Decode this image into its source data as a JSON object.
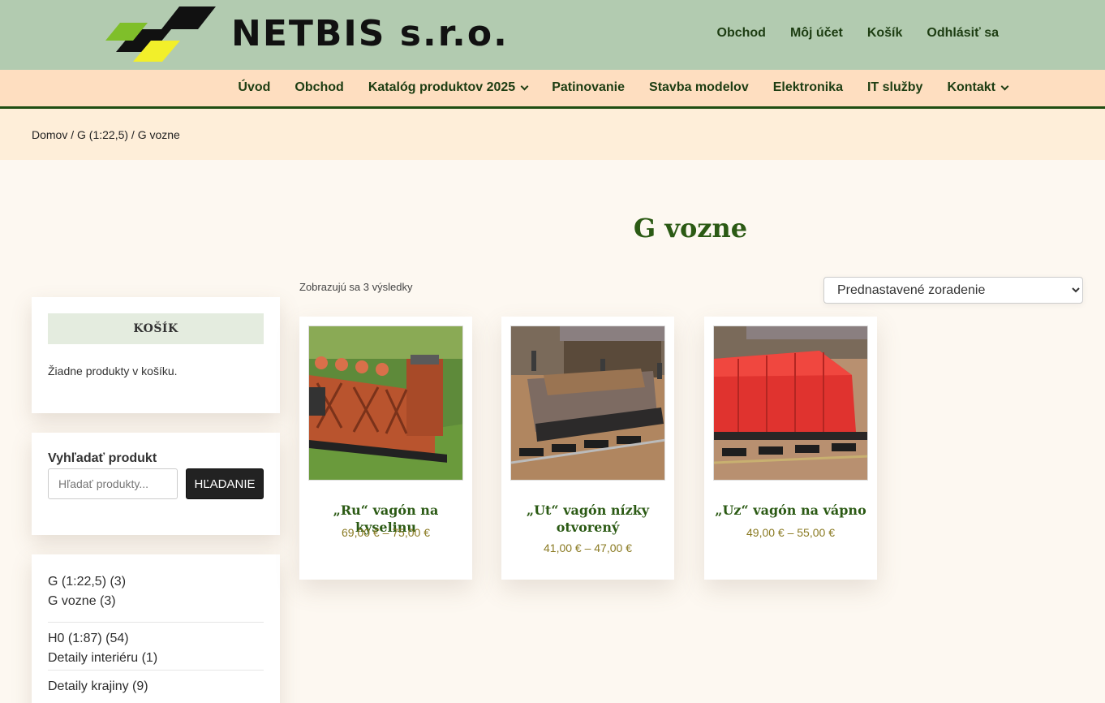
{
  "brand": {
    "name": "NETBIS s.r.o."
  },
  "top_nav": [
    "Obchod",
    "Môj účet",
    "Košík",
    "Odhlásiť sa"
  ],
  "main_nav": [
    {
      "label": "Úvod",
      "dropdown": false
    },
    {
      "label": "Obchod",
      "dropdown": false
    },
    {
      "label": "Katalóg produktov 2025",
      "dropdown": true
    },
    {
      "label": "Patinovanie",
      "dropdown": false
    },
    {
      "label": "Stavba modelov",
      "dropdown": false
    },
    {
      "label": "Elektronika",
      "dropdown": false
    },
    {
      "label": "IT služby",
      "dropdown": false
    },
    {
      "label": "Kontakt",
      "dropdown": true
    }
  ],
  "breadcrumb": "Domov / G (1:22,5) / G vozne",
  "page_title": "G vozne",
  "cart": {
    "title": "KOŠÍK",
    "empty_text": "Žiadne produkty v košíku."
  },
  "search": {
    "title": "Vyhľadať produkt",
    "placeholder": "Hľadať produkty...",
    "button": "HĽADANIE"
  },
  "categories": [
    [
      "G (1:22,5) (3)",
      "G vozne (3)"
    ],
    [
      "H0 (1:87) (54)",
      "Detaily interiéru (1)"
    ],
    [
      "Detaily krajiny (9)"
    ]
  ],
  "results_text": "Zobrazujú sa 3 výsledky",
  "sort": {
    "selected": "Prednastavené zoradenie"
  },
  "products": [
    {
      "title": "„Ru“ vagón na kyselinu",
      "price": "69,00 € – 75,00 €"
    },
    {
      "title": "„Ut“ vagón nízky otvorený",
      "price": "41,00 € – 47,00 €"
    },
    {
      "title": "„Uz“ vagón na vápno",
      "price": "49,00 € – 55,00 €"
    }
  ],
  "colors": {
    "topbar": "#b2cbb0",
    "mainnav": "#fedec0",
    "accent_green": "#2b5a14",
    "price": "#8a7a22"
  }
}
